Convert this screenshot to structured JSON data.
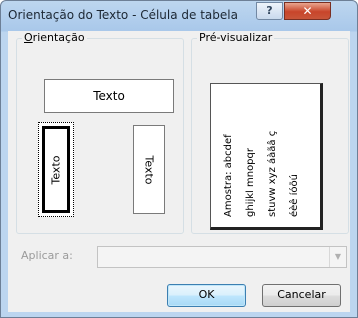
{
  "window": {
    "title": "Orientação do Texto - Célula de tabela",
    "help_glyph": "?",
    "close_glyph": "✕"
  },
  "orientation": {
    "label_accel": "O",
    "label_rest": "rientação",
    "horizontal_text": "Texto",
    "vertical_up_text": "Texto",
    "vertical_down_text": "Texto"
  },
  "preview": {
    "label": "Pré-visualizar",
    "lines": [
      "Amostra: abcdef",
      "ghijkl mnopqr",
      "stuvw xyz áàãâ ç",
      "éèê íóõú"
    ]
  },
  "apply": {
    "label": "Aplicar a:",
    "value": ""
  },
  "buttons": {
    "ok": "OK",
    "cancel": "Cancelar"
  },
  "colors": {
    "titlebar": "#a9c8ea",
    "close_button": "#c8452a",
    "dialog_face": "#f0f0f0"
  },
  "icons": {
    "help": "help-icon",
    "close": "close-icon",
    "dropdown": "chevron-down-icon"
  }
}
